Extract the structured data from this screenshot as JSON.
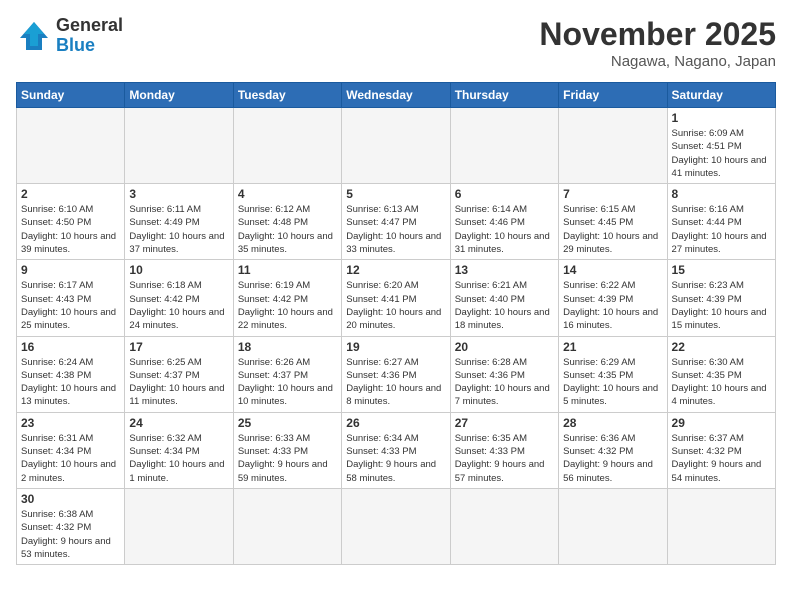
{
  "logo": {
    "text_general": "General",
    "text_blue": "Blue"
  },
  "title": "November 2025",
  "location": "Nagawa, Nagano, Japan",
  "days_of_week": [
    "Sunday",
    "Monday",
    "Tuesday",
    "Wednesday",
    "Thursday",
    "Friday",
    "Saturday"
  ],
  "weeks": [
    [
      {
        "day": "",
        "info": ""
      },
      {
        "day": "",
        "info": ""
      },
      {
        "day": "",
        "info": ""
      },
      {
        "day": "",
        "info": ""
      },
      {
        "day": "",
        "info": ""
      },
      {
        "day": "",
        "info": ""
      },
      {
        "day": "1",
        "info": "Sunrise: 6:09 AM\nSunset: 4:51 PM\nDaylight: 10 hours and 41 minutes."
      }
    ],
    [
      {
        "day": "2",
        "info": "Sunrise: 6:10 AM\nSunset: 4:50 PM\nDaylight: 10 hours and 39 minutes."
      },
      {
        "day": "3",
        "info": "Sunrise: 6:11 AM\nSunset: 4:49 PM\nDaylight: 10 hours and 37 minutes."
      },
      {
        "day": "4",
        "info": "Sunrise: 6:12 AM\nSunset: 4:48 PM\nDaylight: 10 hours and 35 minutes."
      },
      {
        "day": "5",
        "info": "Sunrise: 6:13 AM\nSunset: 4:47 PM\nDaylight: 10 hours and 33 minutes."
      },
      {
        "day": "6",
        "info": "Sunrise: 6:14 AM\nSunset: 4:46 PM\nDaylight: 10 hours and 31 minutes."
      },
      {
        "day": "7",
        "info": "Sunrise: 6:15 AM\nSunset: 4:45 PM\nDaylight: 10 hours and 29 minutes."
      },
      {
        "day": "8",
        "info": "Sunrise: 6:16 AM\nSunset: 4:44 PM\nDaylight: 10 hours and 27 minutes."
      }
    ],
    [
      {
        "day": "9",
        "info": "Sunrise: 6:17 AM\nSunset: 4:43 PM\nDaylight: 10 hours and 25 minutes."
      },
      {
        "day": "10",
        "info": "Sunrise: 6:18 AM\nSunset: 4:42 PM\nDaylight: 10 hours and 24 minutes."
      },
      {
        "day": "11",
        "info": "Sunrise: 6:19 AM\nSunset: 4:42 PM\nDaylight: 10 hours and 22 minutes."
      },
      {
        "day": "12",
        "info": "Sunrise: 6:20 AM\nSunset: 4:41 PM\nDaylight: 10 hours and 20 minutes."
      },
      {
        "day": "13",
        "info": "Sunrise: 6:21 AM\nSunset: 4:40 PM\nDaylight: 10 hours and 18 minutes."
      },
      {
        "day": "14",
        "info": "Sunrise: 6:22 AM\nSunset: 4:39 PM\nDaylight: 10 hours and 16 minutes."
      },
      {
        "day": "15",
        "info": "Sunrise: 6:23 AM\nSunset: 4:39 PM\nDaylight: 10 hours and 15 minutes."
      }
    ],
    [
      {
        "day": "16",
        "info": "Sunrise: 6:24 AM\nSunset: 4:38 PM\nDaylight: 10 hours and 13 minutes."
      },
      {
        "day": "17",
        "info": "Sunrise: 6:25 AM\nSunset: 4:37 PM\nDaylight: 10 hours and 11 minutes."
      },
      {
        "day": "18",
        "info": "Sunrise: 6:26 AM\nSunset: 4:37 PM\nDaylight: 10 hours and 10 minutes."
      },
      {
        "day": "19",
        "info": "Sunrise: 6:27 AM\nSunset: 4:36 PM\nDaylight: 10 hours and 8 minutes."
      },
      {
        "day": "20",
        "info": "Sunrise: 6:28 AM\nSunset: 4:36 PM\nDaylight: 10 hours and 7 minutes."
      },
      {
        "day": "21",
        "info": "Sunrise: 6:29 AM\nSunset: 4:35 PM\nDaylight: 10 hours and 5 minutes."
      },
      {
        "day": "22",
        "info": "Sunrise: 6:30 AM\nSunset: 4:35 PM\nDaylight: 10 hours and 4 minutes."
      }
    ],
    [
      {
        "day": "23",
        "info": "Sunrise: 6:31 AM\nSunset: 4:34 PM\nDaylight: 10 hours and 2 minutes."
      },
      {
        "day": "24",
        "info": "Sunrise: 6:32 AM\nSunset: 4:34 PM\nDaylight: 10 hours and 1 minute."
      },
      {
        "day": "25",
        "info": "Sunrise: 6:33 AM\nSunset: 4:33 PM\nDaylight: 9 hours and 59 minutes."
      },
      {
        "day": "26",
        "info": "Sunrise: 6:34 AM\nSunset: 4:33 PM\nDaylight: 9 hours and 58 minutes."
      },
      {
        "day": "27",
        "info": "Sunrise: 6:35 AM\nSunset: 4:33 PM\nDaylight: 9 hours and 57 minutes."
      },
      {
        "day": "28",
        "info": "Sunrise: 6:36 AM\nSunset: 4:32 PM\nDaylight: 9 hours and 56 minutes."
      },
      {
        "day": "29",
        "info": "Sunrise: 6:37 AM\nSunset: 4:32 PM\nDaylight: 9 hours and 54 minutes."
      }
    ],
    [
      {
        "day": "30",
        "info": "Sunrise: 6:38 AM\nSunset: 4:32 PM\nDaylight: 9 hours and 53 minutes."
      },
      {
        "day": "",
        "info": ""
      },
      {
        "day": "",
        "info": ""
      },
      {
        "day": "",
        "info": ""
      },
      {
        "day": "",
        "info": ""
      },
      {
        "day": "",
        "info": ""
      },
      {
        "day": "",
        "info": ""
      }
    ]
  ]
}
